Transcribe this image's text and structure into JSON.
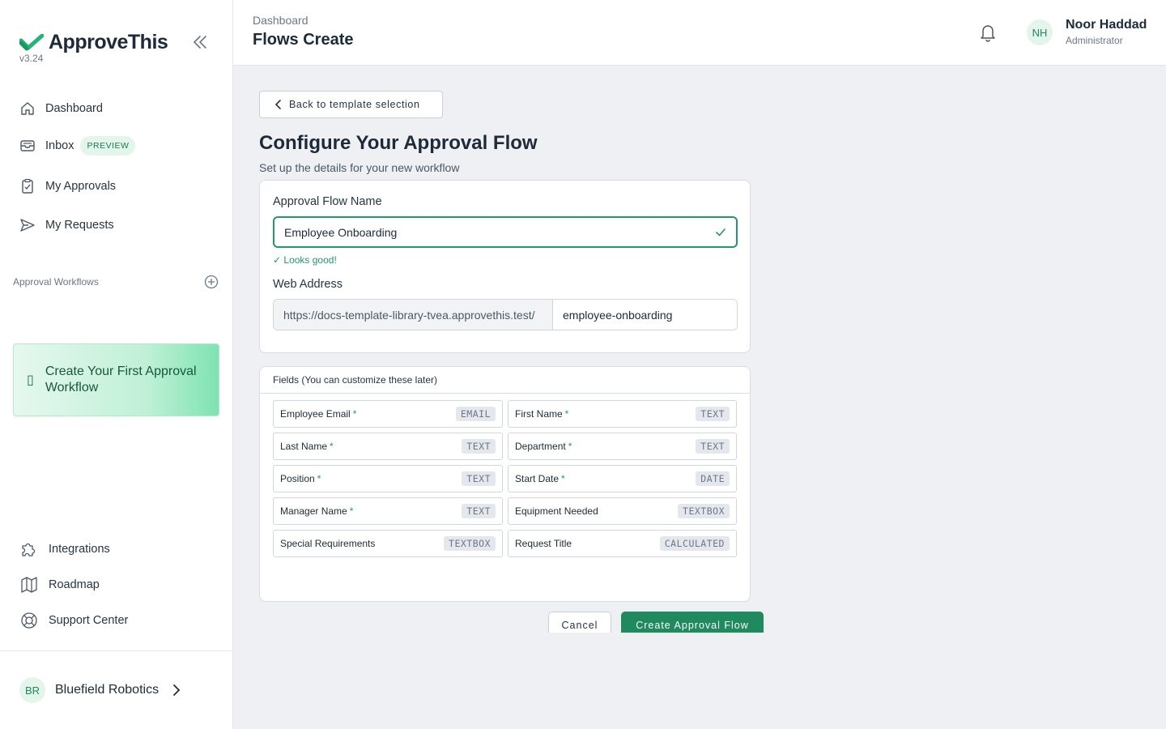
{
  "sidebar": {
    "brand": "ApproveThis",
    "version": "v3.24",
    "nav": [
      {
        "label": "Dashboard",
        "icon": "home-icon"
      },
      {
        "label": "Inbox",
        "icon": "inbox-icon",
        "badge": "PREVIEW"
      },
      {
        "label": "My Approvals",
        "icon": "clipboard-check-icon"
      },
      {
        "label": "My Requests",
        "icon": "send-icon"
      }
    ],
    "section_label": "Approval Workflows",
    "create_card": {
      "label": "Create Your First Approval Workflow",
      "icon": "plus-icon"
    },
    "bottom_nav": [
      {
        "label": "Integrations",
        "icon": "puzzle-icon"
      },
      {
        "label": "Roadmap",
        "icon": "map-icon"
      },
      {
        "label": "Support Center",
        "icon": "lifebuoy-icon"
      }
    ],
    "org": {
      "initials": "BR",
      "name": "Bluefield Robotics"
    }
  },
  "header": {
    "breadcrumb": "Dashboard",
    "title": "Flows Create",
    "user": {
      "initials": "NH",
      "name": "Noor Haddad",
      "role": "Administrator"
    }
  },
  "main": {
    "back_label": "Back to template selection",
    "title": "Configure Your Approval Flow",
    "subtitle": "Set up the details for your new workflow",
    "name_label": "Approval Flow Name",
    "name_value": "Employee Onboarding",
    "validation": "✓ Looks good!",
    "web_label": "Web Address",
    "url_prefix": "https://docs-template-library-tvea.approvethis.test/",
    "url_slug": "employee-onboarding",
    "fields_heading": "Fields (You can customize these later)",
    "fields": [
      {
        "name": "Employee Email",
        "required": true,
        "type": "EMAIL"
      },
      {
        "name": "First Name",
        "required": true,
        "type": "TEXT"
      },
      {
        "name": "Last Name",
        "required": true,
        "type": "TEXT"
      },
      {
        "name": "Department",
        "required": true,
        "type": "TEXT"
      },
      {
        "name": "Position",
        "required": true,
        "type": "TEXT"
      },
      {
        "name": "Start Date",
        "required": true,
        "type": "DATE"
      },
      {
        "name": "Manager Name",
        "required": true,
        "type": "TEXT"
      },
      {
        "name": "Equipment Needed",
        "required": false,
        "type": "TEXTBOX"
      },
      {
        "name": "Special Requirements",
        "required": false,
        "type": "TEXTBOX"
      },
      {
        "name": "Request Title",
        "required": false,
        "type": "CALCULATED"
      }
    ],
    "cancel_label": "Cancel",
    "create_label": "Create Approval Flow"
  },
  "colors": {
    "accent": "#1e8a5e",
    "success": "#1f9a68",
    "badge_bg": "#e4e8ed"
  }
}
